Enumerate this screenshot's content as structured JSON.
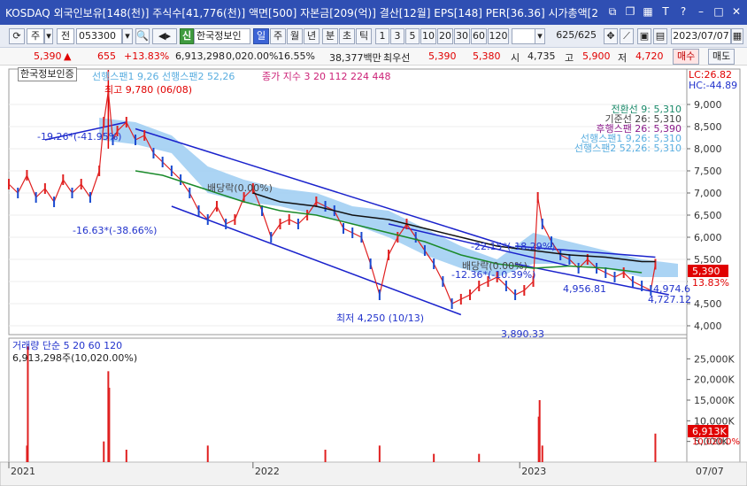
{
  "window": {
    "title": "KOSDAQ 외국인보유[148(천)] 주식수[41,776(천)] 액면[500] 자본금[209(억)] 결산[12월] EPS[148] PER[36.36] 시가총액[2",
    "icons": [
      "restore-icon",
      "copy-icon",
      "grid-icon",
      "text-icon",
      "help-icon",
      "minimize-icon",
      "maximize-icon",
      "close-icon"
    ]
  },
  "toolbar": {
    "stock_code": "053300",
    "market_label": "주",
    "prev_label": "전",
    "stock_name": "한국정보인",
    "period_tabs": [
      "일",
      "주",
      "월",
      "년",
      "분",
      "초",
      "틱"
    ],
    "active_period": "일",
    "numbers": [
      "1",
      "3",
      "5",
      "10",
      "20",
      "30",
      "60",
      "120"
    ],
    "count": "625",
    "total": "/625",
    "date": "2023/07/07"
  },
  "quote": {
    "price": "5,390",
    "arrow": "▲",
    "change": "655",
    "change_pct": "+13.83%",
    "volume": "6,913,298",
    "vol_pct": "0,020.00%",
    "turnover": "16.55%",
    "amount": "38,377백만",
    "best_label": "최우선",
    "best_sell": "5,390",
    "best_buy": "5,380",
    "open_label": "시",
    "open": "4,735",
    "high_label": "고",
    "high": "5,900",
    "low_label": "저",
    "low": "4,720",
    "sell_btn": "매수",
    "buy_btn": "매도"
  },
  "chart_data": {
    "type": "line",
    "stock": "한국정보인증",
    "indicators_text": "선행스팬1 9,26 선행스팬2 52,26",
    "ma_text": "종가 지수 3 20 112 224 448",
    "lc": "LC:26.82",
    "hc": "HC:-44.89",
    "price_axis": [
      "9,000",
      "8,500",
      "8,000",
      "7,500",
      "7,000",
      "6,500",
      "6,000",
      "5,500",
      "5,000",
      "4,500",
      "4,000"
    ],
    "ylim": [
      3800,
      9800
    ],
    "volume_axis": [
      "25,000K",
      "20,000K",
      "15,000K",
      "10,000K",
      "5,000K"
    ],
    "x_labels": [
      "2021",
      "2022",
      "2023",
      "07/07"
    ],
    "annotations": {
      "max": "최고 9,780 (06/08)",
      "min": "최저 4,250 (10/13)",
      "trend1": "-19.26*(-41.95%)",
      "trend2": "-16.63*(-38.66%)",
      "trend3": "-22.15*(-18.29%)",
      "trend4": "-12.36*(-10.39%)",
      "dividend1": "배당락(0.00%)",
      "dividend2": "배당락(0.00%)",
      "lvl1": "3,890.33",
      "lvl2": "4,974.6",
      "lvl3": "4,727.12",
      "lvl4": "4,956.81"
    },
    "ichimoku_legend": [
      {
        "label": "전환선 9: 5,310",
        "color": "#1a8a6a"
      },
      {
        "label": "기준선 26: 5,310",
        "color": "#444444"
      },
      {
        "label": "후행스팬 26: 5,390",
        "color": "#8a1a8a"
      },
      {
        "label": "선행스팬1 9,26: 5,310",
        "color": "#5aaee0"
      },
      {
        "label": "선행스팬2 52,26: 5,310",
        "color": "#5aaee0"
      }
    ],
    "price_tags": {
      "current": "5,390",
      "pct": "13.83%"
    },
    "volume_label": "거래량 단순 5 20 60 120",
    "volume_value": "6,913,298주(10,020.00%)",
    "volume_tag": "6,913K",
    "volume_tag2": "10,020.0%",
    "price_series": [
      [
        0,
        7200
      ],
      [
        10,
        7000
      ],
      [
        20,
        7400
      ],
      [
        30,
        6900
      ],
      [
        40,
        7100
      ],
      [
        50,
        6800
      ],
      [
        60,
        7300
      ],
      [
        70,
        7000
      ],
      [
        80,
        7200
      ],
      [
        90,
        6900
      ],
      [
        100,
        7500
      ],
      [
        105,
        8600
      ],
      [
        110,
        9300
      ],
      [
        115,
        8200
      ],
      [
        120,
        8400
      ],
      [
        130,
        8600
      ],
      [
        140,
        8200
      ],
      [
        150,
        8300
      ],
      [
        160,
        7900
      ],
      [
        170,
        7700
      ],
      [
        180,
        7500
      ],
      [
        190,
        7300
      ],
      [
        200,
        7000
      ],
      [
        210,
        6600
      ],
      [
        220,
        6400
      ],
      [
        230,
        6700
      ],
      [
        240,
        6300
      ],
      [
        250,
        6400
      ],
      [
        260,
        6900
      ],
      [
        270,
        7100
      ],
      [
        280,
        6600
      ],
      [
        290,
        6000
      ],
      [
        300,
        6300
      ],
      [
        310,
        6400
      ],
      [
        320,
        6300
      ],
      [
        330,
        6500
      ],
      [
        340,
        6800
      ],
      [
        350,
        6700
      ],
      [
        360,
        6600
      ],
      [
        370,
        6200
      ],
      [
        380,
        6100
      ],
      [
        390,
        6000
      ],
      [
        400,
        5400
      ],
      [
        410,
        4700
      ],
      [
        420,
        5600
      ],
      [
        430,
        6000
      ],
      [
        440,
        6300
      ],
      [
        450,
        6000
      ],
      [
        460,
        5700
      ],
      [
        470,
        5400
      ],
      [
        480,
        5000
      ],
      [
        490,
        4500
      ],
      [
        500,
        4600
      ],
      [
        510,
        4700
      ],
      [
        520,
        4900
      ],
      [
        530,
        5000
      ],
      [
        540,
        5100
      ],
      [
        550,
        4900
      ],
      [
        560,
        4700
      ],
      [
        570,
        4800
      ],
      [
        580,
        5000
      ],
      [
        585,
        6900
      ],
      [
        590,
        6300
      ],
      [
        600,
        5900
      ],
      [
        610,
        5600
      ],
      [
        620,
        5500
      ],
      [
        630,
        5300
      ],
      [
        640,
        5500
      ],
      [
        650,
        5300
      ],
      [
        660,
        5200
      ],
      [
        670,
        5100
      ],
      [
        680,
        5200
      ],
      [
        690,
        5000
      ],
      [
        700,
        4900
      ],
      [
        710,
        4800
      ],
      [
        715,
        5390
      ]
    ],
    "ma_green": [
      [
        140,
        7500
      ],
      [
        170,
        7400
      ],
      [
        200,
        7200
      ],
      [
        230,
        7000
      ],
      [
        260,
        6800
      ],
      [
        300,
        6600
      ],
      [
        340,
        6500
      ],
      [
        380,
        6300
      ],
      [
        420,
        6100
      ],
      [
        460,
        5900
      ],
      [
        500,
        5600
      ],
      [
        540,
        5400
      ],
      [
        580,
        5300
      ],
      [
        620,
        5350
      ],
      [
        660,
        5300
      ],
      [
        700,
        5200
      ]
    ],
    "ma_black": [
      [
        270,
        7000
      ],
      [
        300,
        6800
      ],
      [
        340,
        6700
      ],
      [
        380,
        6500
      ],
      [
        420,
        6400
      ],
      [
        460,
        6200
      ],
      [
        500,
        6000
      ],
      [
        540,
        5800
      ],
      [
        580,
        5700
      ],
      [
        620,
        5600
      ],
      [
        660,
        5550
      ],
      [
        700,
        5450
      ],
      [
        715,
        5450
      ]
    ],
    "cloud_series": [
      [
        100,
        8200,
        8700
      ],
      [
        140,
        8100,
        8600
      ],
      [
        180,
        7900,
        8300
      ],
      [
        220,
        7000,
        7600
      ],
      [
        260,
        6800,
        7300
      ],
      [
        300,
        6700,
        7100
      ],
      [
        340,
        6500,
        7000
      ],
      [
        380,
        6300,
        6700
      ],
      [
        420,
        6000,
        6600
      ],
      [
        460,
        5600,
        6200
      ],
      [
        500,
        5300,
        5800
      ],
      [
        540,
        5100,
        5500
      ],
      [
        580,
        5400,
        6100
      ],
      [
        620,
        5400,
        5900
      ],
      [
        660,
        5300,
        5700
      ],
      [
        700,
        5100,
        5500
      ],
      [
        740,
        5100,
        5400
      ]
    ],
    "volume_bars": [
      [
        20,
        4
      ],
      [
        21,
        28
      ],
      [
        105,
        5
      ],
      [
        110,
        22
      ],
      [
        111,
        18
      ],
      [
        130,
        3
      ],
      [
        220,
        4
      ],
      [
        350,
        3
      ],
      [
        410,
        4
      ],
      [
        470,
        2
      ],
      [
        520,
        2
      ],
      [
        586,
        11
      ],
      [
        587,
        15
      ],
      [
        590,
        4
      ],
      [
        715,
        6.9
      ]
    ]
  }
}
